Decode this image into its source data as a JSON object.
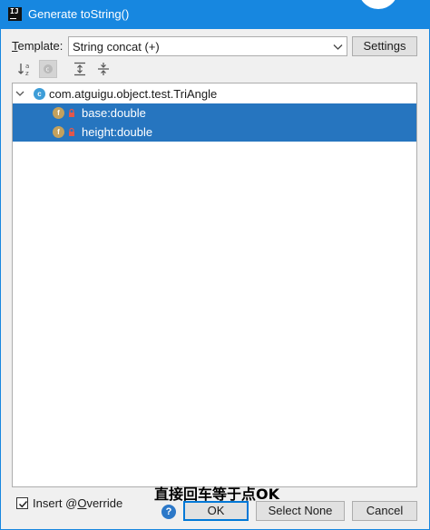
{
  "window": {
    "title": "Generate toString()",
    "app_icon_text": "IJ"
  },
  "template": {
    "label_mnemonic": "T",
    "label_rest": "emplate:",
    "selected": "String concat (+)",
    "settings_label": "Settings"
  },
  "toolbar": {
    "icons": [
      "sort-alpha-icon",
      "sort-class-icon",
      "expand-all-icon",
      "collapse-all-icon"
    ]
  },
  "tree": {
    "root": {
      "icon_letter": "c",
      "label": "com.atguigu.object.test.TriAngle"
    },
    "fields": [
      {
        "icon_letter": "f",
        "label": "base:double",
        "selected": true
      },
      {
        "icon_letter": "f",
        "label": "height:double",
        "selected": true
      }
    ]
  },
  "footer": {
    "override_label_prefix": "Insert @",
    "override_label_mnemonic": "O",
    "override_label_rest": "verride",
    "override_checked": true,
    "annotation": "直接回车等于点OK",
    "help_glyph": "?",
    "ok_label": "OK",
    "select_none_label": "Select None",
    "cancel_label": "Cancel"
  },
  "colors": {
    "titlebar": "#1787e0",
    "selection": "#2675bf",
    "class_icon": "#3d9dd8",
    "field_icon": "#c3a15d",
    "lock": "#e2574c",
    "default_button_border": "#0078d7"
  }
}
